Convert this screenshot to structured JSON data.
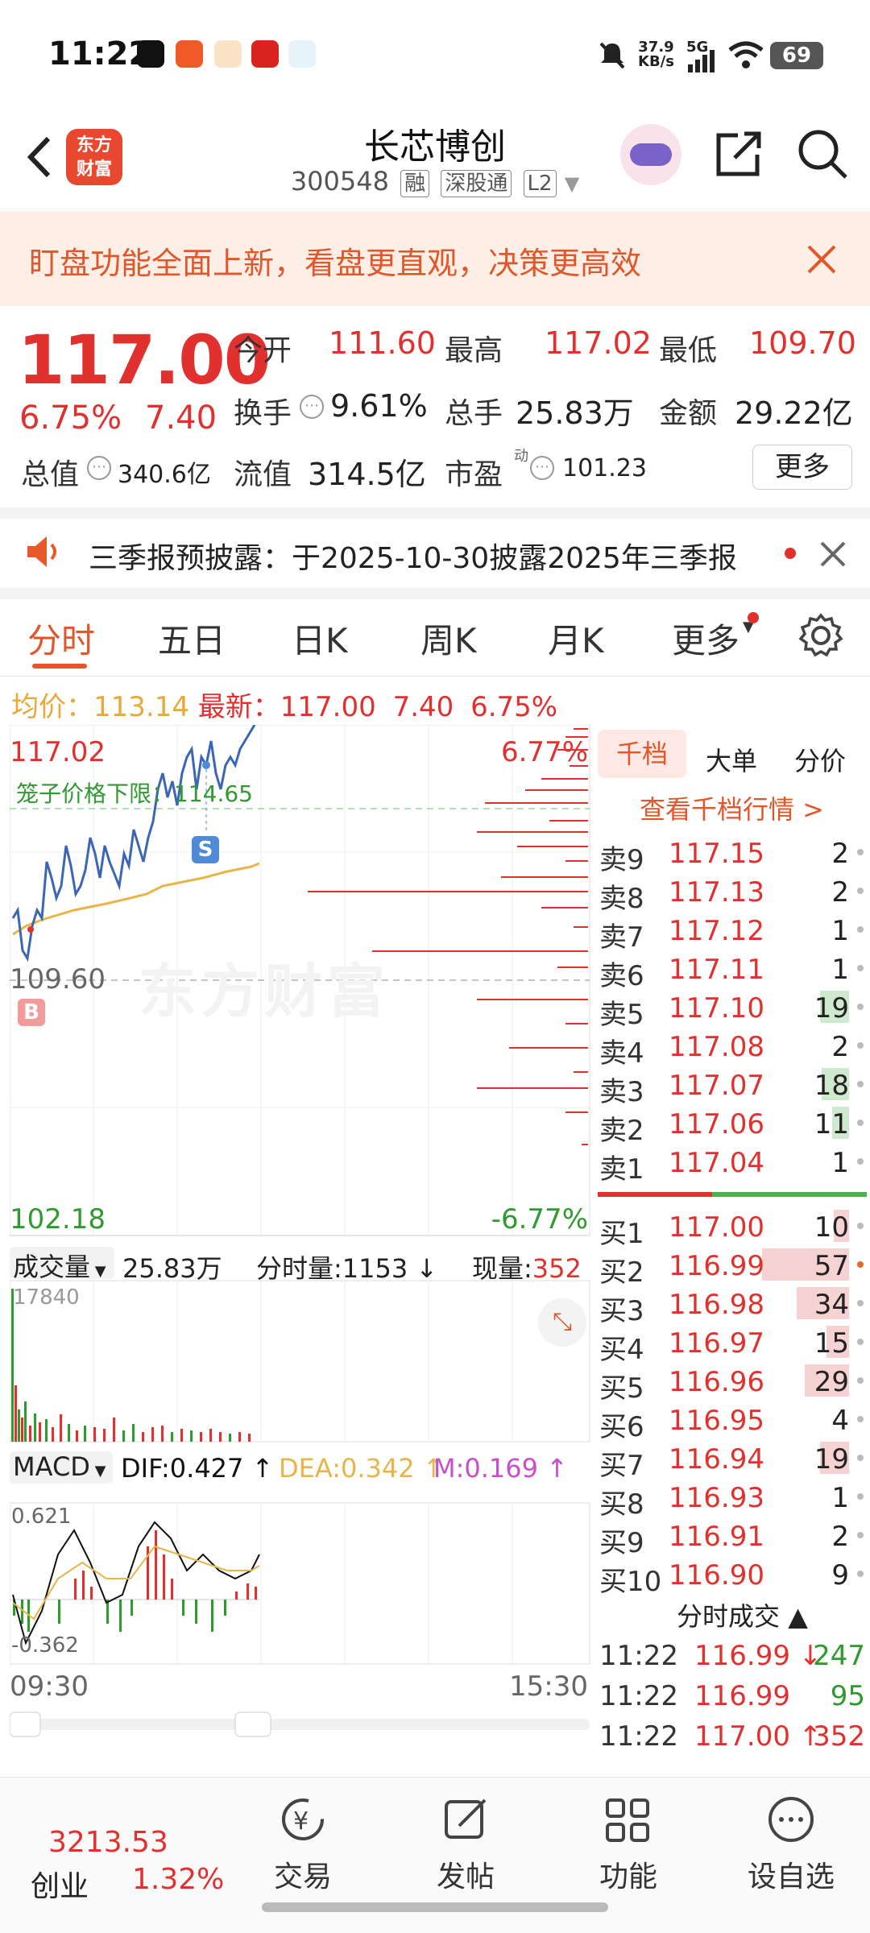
{
  "status": {
    "time": "11:22",
    "net_speed_top": "37.9",
    "net_speed_bottom": "KB/s",
    "signal": "5G",
    "battery": "69"
  },
  "header": {
    "title": "长芯博创",
    "code": "300548",
    "tags": [
      "融",
      "深股通",
      "L2"
    ]
  },
  "banner": {
    "text": "盯盘功能全面上新，看盘更直观，决策更高效"
  },
  "quote": {
    "price": "117.00",
    "pct": "6.75%",
    "change": "7.40",
    "open_label": "今开",
    "open": "111.60",
    "high_label": "最高",
    "high": "117.02",
    "low_label": "最低",
    "low": "109.70",
    "turnover_label": "换手",
    "turnover": "9.61%",
    "volume_label": "总手",
    "volume": "25.83万",
    "amount_label": "金额",
    "amount": "29.22亿",
    "mktcap_label": "总值",
    "mktcap": "340.6亿",
    "float_label": "流值",
    "float_cap": "314.5亿",
    "pe_label": "市盈",
    "pe_sup": "动",
    "pe": "101.23",
    "more_label": "更多"
  },
  "notice": {
    "text": "三季报预披露：于2025-10-30披露2025年三季报"
  },
  "tabs": [
    "分时",
    "五日",
    "日K",
    "周K",
    "月K",
    "更多"
  ],
  "intraday": {
    "avg_label": "均价：",
    "avg": "113.14",
    "latest_label": "最新：",
    "latest": "117.00",
    "latest_change": "7.40",
    "latest_pct": "6.75%",
    "high_price": "117.02",
    "high_pct": "6.77%",
    "low_price": "102.18",
    "low_pct": "-6.77%",
    "prev_close": "109.60",
    "cage_label": "笼子价格下限：114.65",
    "marker_s": "S",
    "marker_b": "B",
    "watermark": "东方财富",
    "vol_label": "成交量",
    "vol_total": "25.83万",
    "vol_minute": "分时量:1153",
    "vol_current_label": "现量:",
    "vol_current": "352",
    "vol_max": "17840",
    "macd_label": "MACD",
    "dif": "DIF:0.427",
    "dea": "DEA:0.342",
    "m": "M:0.169",
    "macd_max": "0.621",
    "macd_min": "-0.362",
    "time_start": "09:30",
    "time_end": "15:30"
  },
  "orderbook": {
    "tabs": [
      "千档",
      "大单",
      "分价"
    ],
    "link": "查看千档行情 >",
    "sells": [
      {
        "label": "卖9",
        "price": "117.15",
        "vol": "2"
      },
      {
        "label": "卖8",
        "price": "117.13",
        "vol": "2"
      },
      {
        "label": "卖7",
        "price": "117.12",
        "vol": "1"
      },
      {
        "label": "卖6",
        "price": "117.11",
        "vol": "1"
      },
      {
        "label": "卖5",
        "price": "117.10",
        "vol": "19"
      },
      {
        "label": "卖4",
        "price": "117.08",
        "vol": "2"
      },
      {
        "label": "卖3",
        "price": "117.07",
        "vol": "18"
      },
      {
        "label": "卖2",
        "price": "117.06",
        "vol": "11"
      },
      {
        "label": "卖1",
        "price": "117.04",
        "vol": "1"
      }
    ],
    "buys": [
      {
        "label": "买1",
        "price": "117.00",
        "vol": "10"
      },
      {
        "label": "买2",
        "price": "116.99",
        "vol": "57"
      },
      {
        "label": "买3",
        "price": "116.98",
        "vol": "34"
      },
      {
        "label": "买4",
        "price": "116.97",
        "vol": "15"
      },
      {
        "label": "买5",
        "price": "116.96",
        "vol": "29"
      },
      {
        "label": "买6",
        "price": "116.95",
        "vol": "4"
      },
      {
        "label": "买7",
        "price": "116.94",
        "vol": "19"
      },
      {
        "label": "买8",
        "price": "116.93",
        "vol": "1"
      },
      {
        "label": "买9",
        "price": "116.91",
        "vol": "2"
      },
      {
        "label": "买10",
        "price": "116.90",
        "vol": "9"
      }
    ],
    "ticks_title": "分时成交",
    "ticks": [
      {
        "time": "11:22",
        "price": "116.99",
        "arrow": "↓",
        "vol": "247"
      },
      {
        "time": "11:22",
        "price": "116.99",
        "arrow": "",
        "vol": "95"
      },
      {
        "time": "11:22",
        "price": "117.00",
        "arrow": "↑",
        "vol": "352"
      }
    ]
  },
  "bottom": {
    "index_value": "3213.53",
    "index_name": "创业",
    "index_pct": "1.32%",
    "items": [
      "交易",
      "发帖",
      "功能",
      "设自选"
    ]
  },
  "colors": {
    "up": "#e0312f",
    "down": "#2f9a2f",
    "accent": "#e0572b",
    "avg_line": "#e8b54a",
    "price_line": "#3a66b5"
  }
}
